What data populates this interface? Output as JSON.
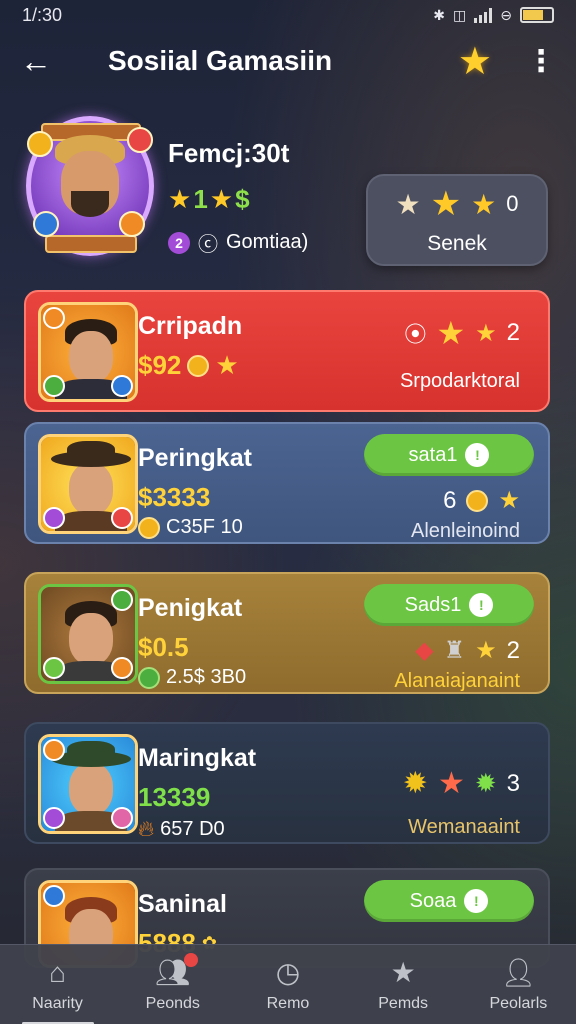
{
  "status_bar": {
    "time": "1/:30"
  },
  "header": {
    "title": "Sosiial Gamasiin",
    "back_icon": "arrow-left-icon",
    "star_icon": "star-icon"
  },
  "profile": {
    "name": "Femcj:30t",
    "stars_value": "1",
    "stars_extra": "$",
    "meta_badge": "2",
    "meta_text": "Gomtiaa)",
    "action": {
      "label": "Senek",
      "count": "0"
    }
  },
  "cards": [
    {
      "name": "Crripadn",
      "amount": "$92",
      "sub": "",
      "button_label": "",
      "icons_text": "2",
      "tag": "Srpodarktoral",
      "colors": {
        "bg": "#e9443e"
      }
    },
    {
      "name": "Peringkat",
      "amount": "$3333",
      "sub": "C35F 10",
      "button_label": "sata1",
      "icons_text": "6",
      "tag": "Alenleinoind",
      "colors": {
        "bg": "#4b6491"
      }
    },
    {
      "name": "Penigkat",
      "amount": "$0.5",
      "sub": "2.5$ 3B0",
      "button_label": "Sads1",
      "icons_text": "2",
      "tag": "Alanaiajanaint",
      "colors": {
        "bg": "#a6823b"
      }
    },
    {
      "name": "Maringkat",
      "amount": "13339",
      "sub": "657 D0",
      "button_label": "",
      "icons_text": "3",
      "tag": "Wemanaaint",
      "colors": {
        "bg": "#2e3a50"
      }
    },
    {
      "name": "Saninal",
      "amount": "5888",
      "sub": "",
      "button_label": "Soaa",
      "icons_text": "",
      "tag": "",
      "colors": {
        "bg": "#3b3f4a"
      }
    }
  ],
  "bottom_nav": [
    {
      "label": "Naarity",
      "icon": "home-icon"
    },
    {
      "label": "Peonds",
      "icon": "friends-icon"
    },
    {
      "label": "Remo",
      "icon": "clock-icon"
    },
    {
      "label": "Pemds",
      "icon": "badge-icon"
    },
    {
      "label": "Peolarls",
      "icon": "profile-icon"
    }
  ]
}
